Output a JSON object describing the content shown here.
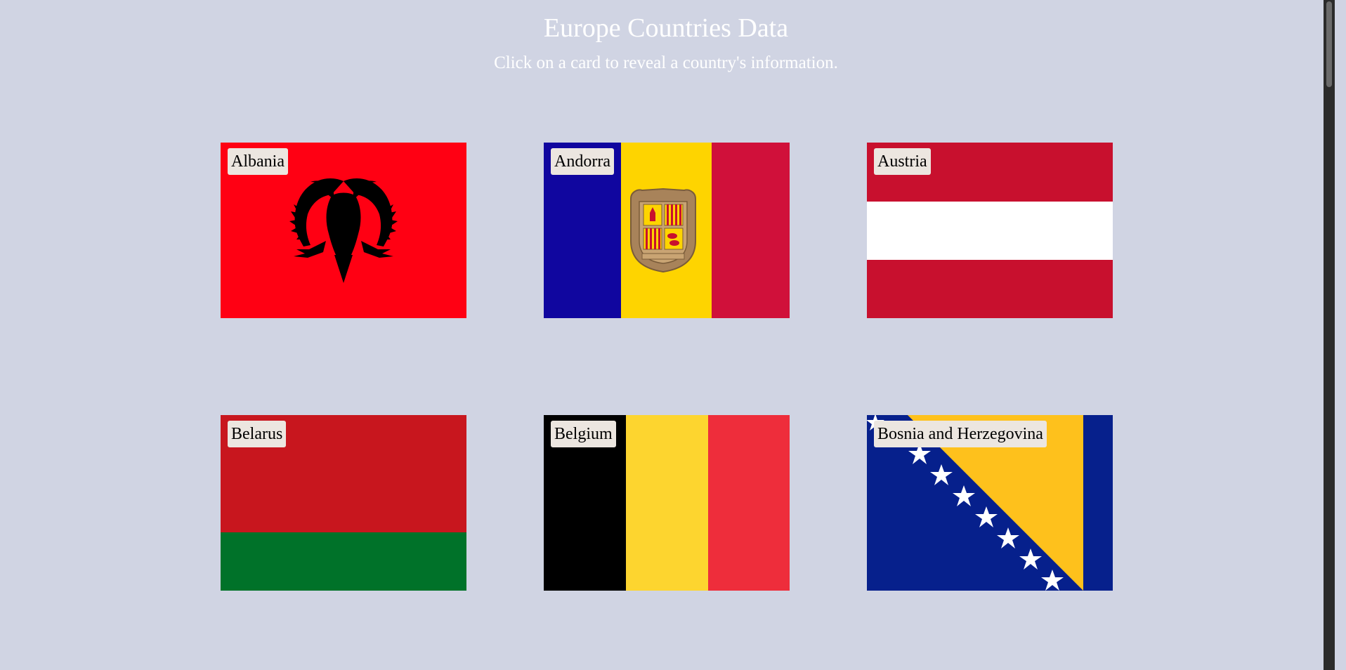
{
  "header": {
    "title": "Europe Countries Data",
    "subtitle": "Click on a card to reveal a country's information."
  },
  "cards": [
    {
      "name": "Albania",
      "flag_colors": [
        "#ff0013",
        "#000000"
      ]
    },
    {
      "name": "Andorra",
      "flag_colors": [
        "#10069f",
        "#fed400",
        "#d0103a"
      ]
    },
    {
      "name": "Austria",
      "flag_colors": [
        "#c8102e",
        "#ffffff",
        "#c8102e"
      ]
    },
    {
      "name": "Belarus",
      "flag_colors": [
        "#c8161e",
        "#007229"
      ]
    },
    {
      "name": "Belgium",
      "flag_colors": [
        "#000000",
        "#fdd52f",
        "#ee2d3b"
      ]
    },
    {
      "name": "Bosnia and Herzegovina",
      "flag_colors": [
        "#06208c",
        "#fec11c",
        "#ffffff"
      ]
    }
  ],
  "colors": {
    "background": "#d0d4e3",
    "header_text": "#ffffff",
    "label_background": "#ece6e0"
  }
}
